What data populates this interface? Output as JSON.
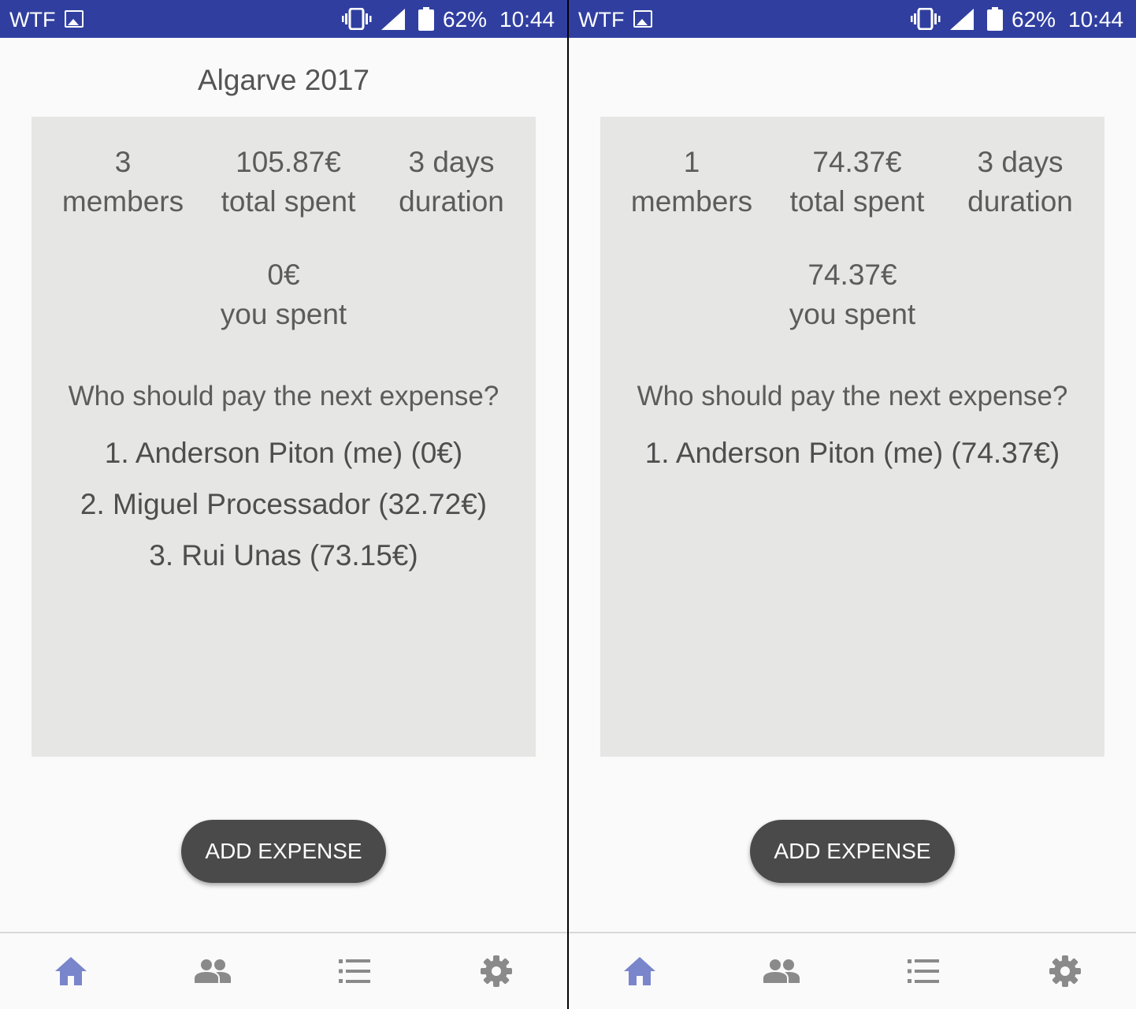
{
  "colors": {
    "status_bar": "#303f9f",
    "card": "#e6e6e5",
    "button": "#4a4a4a",
    "nav_active": "#7986cb",
    "nav_inactive": "#8a8a8a"
  },
  "screens": [
    {
      "status_bar": {
        "carrier": "WTF",
        "battery_percent": "62%",
        "time": "10:44"
      },
      "title": "Algarve 2017",
      "stats": {
        "members_value": "3",
        "members_label": "members",
        "total_value": "105.87€",
        "total_label": "total spent",
        "duration_value": "3 days",
        "duration_label": "duration",
        "you_value": "0€",
        "you_label": "you spent"
      },
      "question": "Who should pay the next expense?",
      "next_payers": [
        "1. Anderson Piton (me) (0€)",
        "2. Miguel Processador (32.72€)",
        "3. Rui Unas (73.15€)"
      ],
      "add_button": "ADD EXPENSE",
      "nav": {
        "items": [
          "home-icon",
          "group-icon",
          "list-icon",
          "settings-icon"
        ],
        "active": "home-icon"
      }
    },
    {
      "status_bar": {
        "carrier": "WTF",
        "battery_percent": "62%",
        "time": "10:44"
      },
      "title": "",
      "stats": {
        "members_value": "1",
        "members_label": "members",
        "total_value": "74.37€",
        "total_label": "total spent",
        "duration_value": "3 days",
        "duration_label": "duration",
        "you_value": "74.37€",
        "you_label": "you spent"
      },
      "question": "Who should pay the next expense?",
      "next_payers": [
        "1. Anderson Piton (me) (74.37€)"
      ],
      "add_button": "ADD EXPENSE",
      "nav": {
        "items": [
          "home-icon",
          "group-icon",
          "list-icon",
          "settings-icon"
        ],
        "active": "home-icon"
      }
    }
  ]
}
